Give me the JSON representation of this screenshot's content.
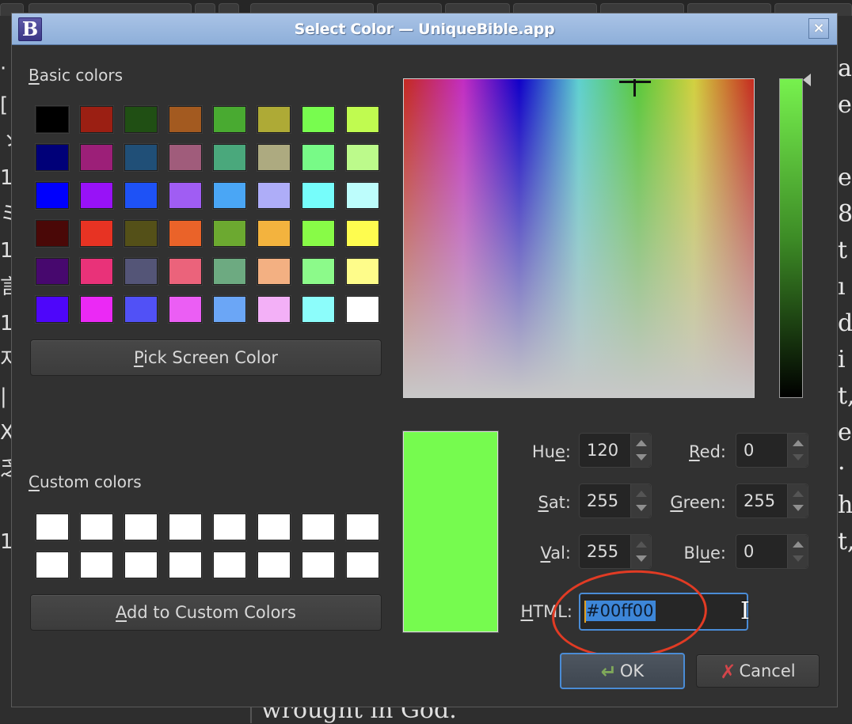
{
  "background": {
    "text_bottom": "wrought in God.",
    "text_right_fragments": [
      "a",
      "e",
      "",
      "e",
      "8",
      "t",
      "ı",
      "d",
      "i",
      "t,",
      "e",
      "·",
      "h",
      "t,"
    ],
    "text_left_fragments": [
      "·",
      "[",
      "ゝ",
      "1",
      "ミ",
      "1",
      "言",
      "1",
      "지",
      "|",
      "X",
      "乏",
      "",
      "1"
    ]
  },
  "dialog": {
    "title": "Select Color — UniqueBible.app",
    "app_icon_letter": "B",
    "close_glyph": "×",
    "basic_colors_label": {
      "mnemonic": "B",
      "rest": "asic colors"
    },
    "basic_colors": [
      [
        "#000000",
        "#9b1f13",
        "#204f14",
        "#a35a20",
        "#49aa31",
        "#aeaa36",
        "#78fc4f",
        "#c0fb50"
      ],
      [
        "#000078",
        "#9c1f78",
        "#204f77",
        "#a05c7b",
        "#4aa87c",
        "#adaa80",
        "#78fa87",
        "#bcfa8b"
      ],
      [
        "#0000fd",
        "#9812f7",
        "#1e52f6",
        "#a05df3",
        "#4aa6f5",
        "#aeadf8",
        "#76fdfb",
        "#bdfdfc"
      ],
      [
        "#4a0807",
        "#e73323",
        "#545018",
        "#ea6329",
        "#6ca930",
        "#f3b33e",
        "#88fb47",
        "#fefc4f"
      ],
      [
        "#47086e",
        "#e93279",
        "#545577",
        "#eb637b",
        "#6daa81",
        "#f3b082",
        "#8cfa8a",
        "#fefc8a"
      ],
      [
        "#4e06fa",
        "#eb29f5",
        "#5151f6",
        "#eb5ef4",
        "#6ba6f6",
        "#f3b0f7",
        "#8cfdfb",
        "#ffffff"
      ]
    ],
    "pick_screen_color": {
      "mnemonic": "P",
      "rest": "ick Screen Color"
    },
    "custom_colors_label": {
      "mnemonic": "C",
      "rest": "ustom colors"
    },
    "custom_colors": [
      [
        "#ffffff",
        "#ffffff",
        "#ffffff",
        "#ffffff",
        "#ffffff",
        "#ffffff",
        "#ffffff",
        "#ffffff"
      ],
      [
        "#ffffff",
        "#ffffff",
        "#ffffff",
        "#ffffff",
        "#ffffff",
        "#ffffff",
        "#ffffff",
        "#ffffff"
      ]
    ],
    "add_to_custom": {
      "mnemonic": "A",
      "rest": "dd to Custom Colors"
    },
    "current_color": "#76fb4f",
    "value_slider_level": 1.0,
    "fields": {
      "hue": {
        "pre": "Hu",
        "mnemonic": "e",
        "post": ":",
        "value": "120"
      },
      "sat": {
        "pre": "",
        "mnemonic": "S",
        "post": "at:",
        "value": "255"
      },
      "val": {
        "pre": "",
        "mnemonic": "V",
        "post": "al:",
        "value": "255"
      },
      "red": {
        "pre": "",
        "mnemonic": "R",
        "post": "ed:",
        "value": "0"
      },
      "green": {
        "pre": "",
        "mnemonic": "G",
        "post": "reen:",
        "value": "255"
      },
      "blue": {
        "pre": "Bl",
        "mnemonic": "u",
        "post": "e:",
        "value": "0"
      }
    },
    "html_label": {
      "mnemonic": "H",
      "rest": "TML:"
    },
    "html_value": "#00ff00",
    "ok_label": "OK",
    "ok_icon": "↵",
    "cancel_label": "Cancel",
    "cancel_icon": "✗",
    "annotation_color": "#e13b24"
  }
}
